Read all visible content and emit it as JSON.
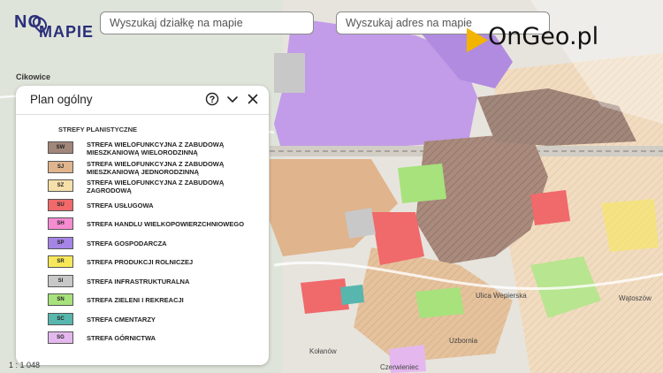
{
  "logo": {
    "text_top": "NO",
    "text_bottom": "MAPIE"
  },
  "search": {
    "parcel_placeholder": "Wyszukaj działkę na mapie",
    "address_placeholder": "Wyszukaj adres na mapie"
  },
  "brand": {
    "text": "OnGeo.pl",
    "accent_color": "#f2b400"
  },
  "map": {
    "labels": [
      "Cikowice",
      "Ulica Wepierska",
      "Uzbornia",
      "Kołanów",
      "Czerwieniec",
      "Wątoszów"
    ]
  },
  "panel": {
    "title": "Plan ogólny",
    "controls": [
      "help-circle-icon",
      "chevron-down-icon",
      "close-icon"
    ],
    "legend_title": "STREFY PLANISTYCZNE",
    "zones": [
      {
        "code": "SW",
        "label": "STREFA WIELOFUNKCYJNA Z ZABUDOWĄ MIESZKANIOWĄ WIELORODZINNĄ",
        "color": "#a1867a"
      },
      {
        "code": "SJ",
        "label": "STREFA WIELOFUNKCYJNA Z ZABUDOWĄ MIESZKANIOWĄ JEDNORODZINNĄ",
        "color": "#e0b48c"
      },
      {
        "code": "SZ",
        "label": "STREFA WIELOFUNKCYJNA Z ZABUDOWĄ ZAGRODOWĄ",
        "color": "#f7dfaa"
      },
      {
        "code": "SU",
        "label": "STREFA USŁUGOWA",
        "color": "#f0696b"
      },
      {
        "code": "SH",
        "label": "STREFA HANDLU WIELKOPOWIERZCHNIOWEGO",
        "color": "#f58bd1"
      },
      {
        "code": "SP",
        "label": "STREFA GOSPODARCZA",
        "color": "#a584e6"
      },
      {
        "code": "SR",
        "label": "STREFA PRODUKCJI ROLNICZEJ",
        "color": "#f7e85a"
      },
      {
        "code": "SI",
        "label": "STREFA INFRASTRUKTURALNA",
        "color": "#c8c8c8"
      },
      {
        "code": "SN",
        "label": "STREFA ZIELENI I REKREACJI",
        "color": "#a7e27c"
      },
      {
        "code": "SC",
        "label": "STREFA CMENTARZY",
        "color": "#57b6ad"
      },
      {
        "code": "SG",
        "label": "STREFA GÓRNICTWA",
        "color": "#e4b8ee"
      }
    ]
  },
  "scale": {
    "text": "1 : 1 048"
  }
}
